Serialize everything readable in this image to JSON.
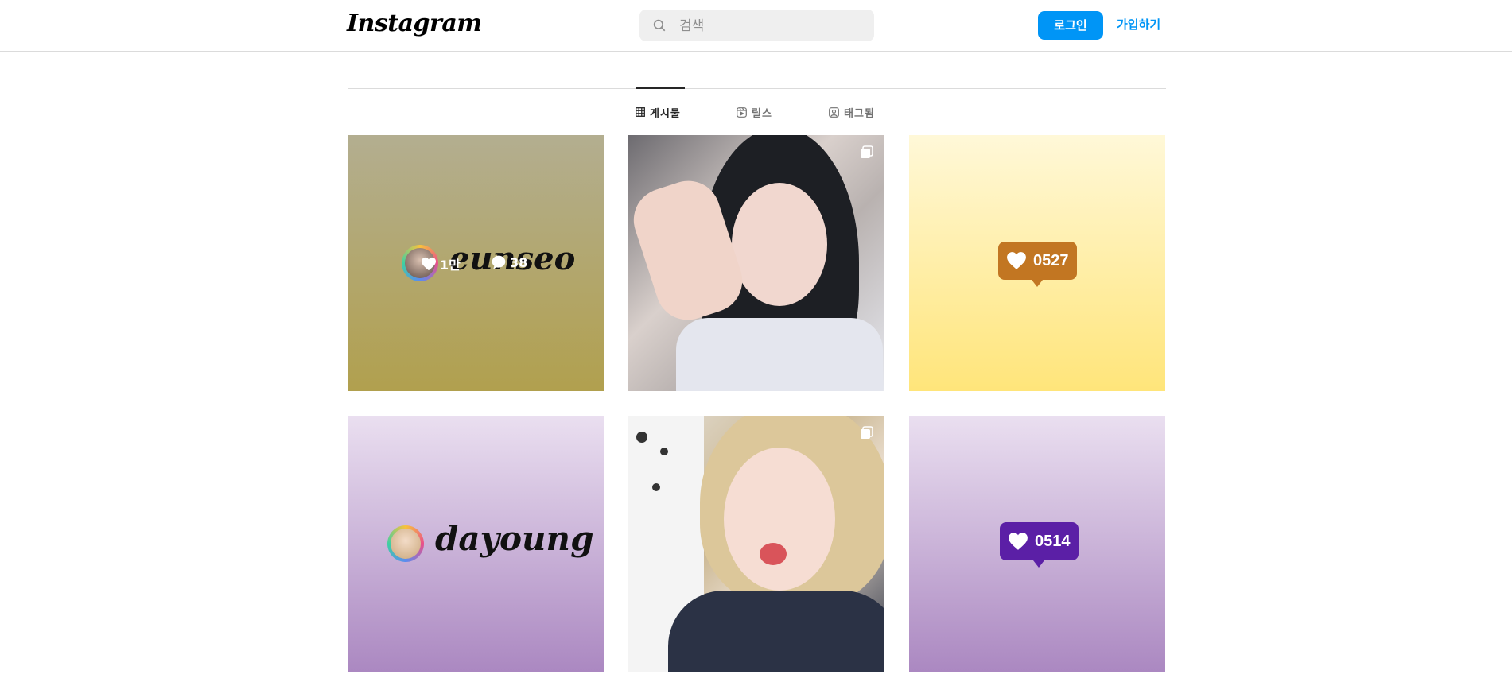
{
  "header": {
    "logo_text": "Instagram",
    "search": {
      "placeholder": "검색",
      "value": ""
    },
    "login_label": "로그인",
    "signup_label": "가입하기",
    "accent_color": "#0095f6"
  },
  "tabs": [
    {
      "label": "게시물",
      "icon": "grid-icon",
      "active": true
    },
    {
      "label": "릴스",
      "icon": "reels-icon",
      "active": false
    },
    {
      "label": "태그됨",
      "icon": "tagged-icon",
      "active": false
    }
  ],
  "posts": [
    {
      "type": "graphic",
      "script_text": "eunseo",
      "likes": "1만",
      "comments": "38",
      "hover_overlay": true
    },
    {
      "type": "photo",
      "multi": true
    },
    {
      "type": "graphic",
      "badge_text": "0527",
      "badge_color": "#c27622"
    },
    {
      "type": "graphic",
      "script_text": "dayoung"
    },
    {
      "type": "photo",
      "multi": true
    },
    {
      "type": "graphic",
      "badge_text": "0514",
      "badge_color": "#5b1fa6"
    }
  ]
}
